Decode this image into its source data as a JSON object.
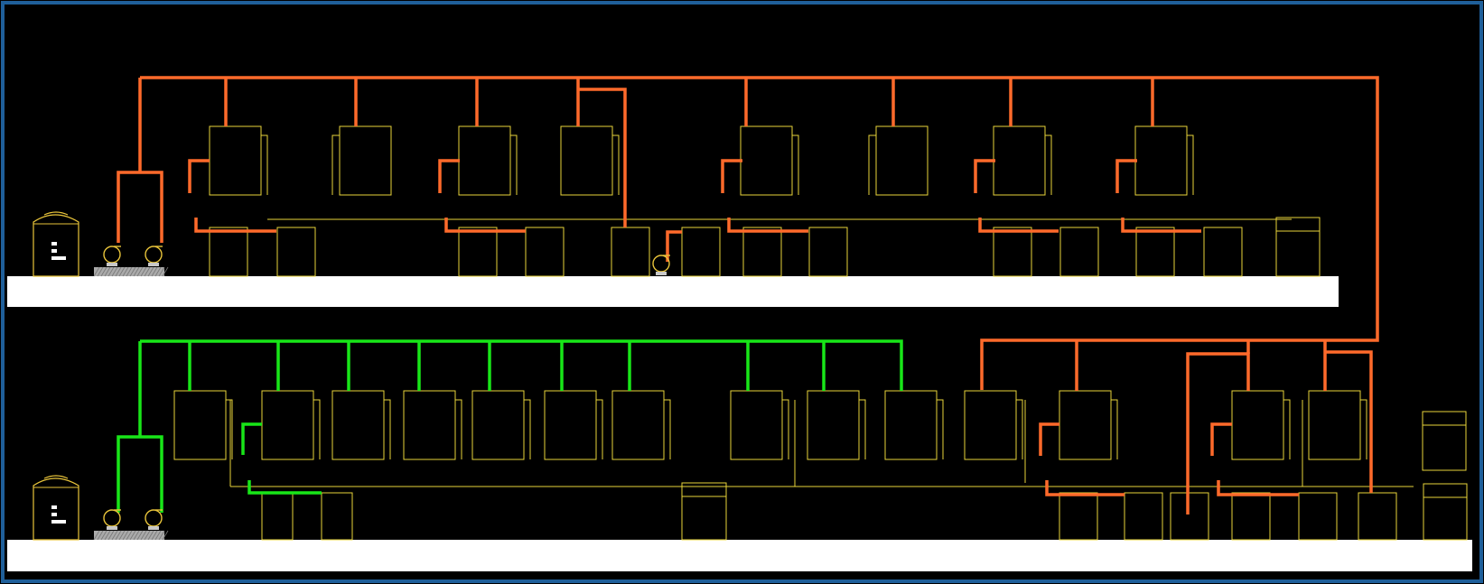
{
  "colors": {
    "background": "#000000",
    "frame": "#1f5f9a",
    "floor": "#ffffff",
    "hot_pipe": "#ff6a2b",
    "cold_pipe": "#18e618",
    "equipment": "#e8d43a",
    "tank": "#e8c43a",
    "tank_label": "#ffffff",
    "pump_base": "#c8c8c8"
  },
  "levels": [
    {
      "name": "upper",
      "pipe": "hot_pipe"
    },
    {
      "name": "lower",
      "pipe": "cold_pipe"
    }
  ]
}
